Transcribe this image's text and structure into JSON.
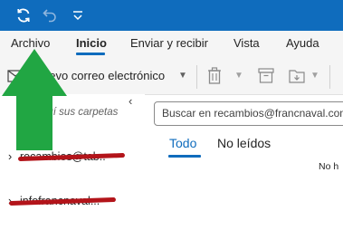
{
  "titlebar": {
    "color": "#0f6cbd",
    "icons": [
      "sync-icon",
      "undo-icon",
      "quick-access-dropdown-icon"
    ]
  },
  "menu": {
    "items": [
      "Archivo",
      "Inicio",
      "Enviar y recibir",
      "Vista",
      "Ayuda"
    ],
    "active": "Inicio"
  },
  "ribbon": {
    "new_email_label": "uevo correo electrónico",
    "icons": [
      "new-mail-icon",
      "delete-icon",
      "archive-icon",
      "move-icon"
    ]
  },
  "folder_pane": {
    "drag_hint": "e aquí sus carpetas",
    "accounts": [
      "recambios@tab..",
      "infofrancnaval..."
    ]
  },
  "search": {
    "placeholder": "Buscar en recambios@francnaval.com"
  },
  "message_list": {
    "tabs": [
      "Todo",
      "No leídos"
    ],
    "active_tab": "Todo",
    "empty_text": "No h"
  },
  "annotation": {
    "arrow_color": "#21a643"
  }
}
